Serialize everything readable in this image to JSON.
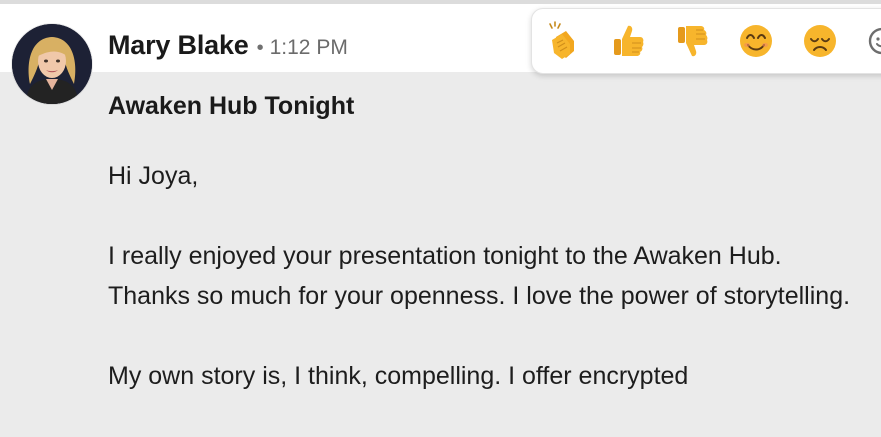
{
  "message": {
    "sender_name": "Mary Blake",
    "separator": "•",
    "timestamp": "1:12 PM",
    "subject": "Awaken Hub Tonight",
    "body": {
      "greeting": "Hi Joya,",
      "paragraph_1": "I really enjoyed your presentation tonight to the Awaken Hub. Thanks so much for your openness. I love the power of storytelling.",
      "paragraph_2": "My own story is, I think, compelling. I offer encrypted"
    }
  },
  "reactions": [
    {
      "icon": "clapping-hands-icon"
    },
    {
      "icon": "thumbs-up-icon"
    },
    {
      "icon": "thumbs-down-icon"
    },
    {
      "icon": "smiling-face-icon"
    },
    {
      "icon": "disappointed-face-icon"
    },
    {
      "icon": "add-reaction-icon"
    }
  ],
  "colors": {
    "background": "#ebebeb",
    "header": "#ffffff",
    "emoji_yellow": "#f7b52c",
    "text": "#1d1d1d",
    "muted_text": "#6b6b6b"
  }
}
